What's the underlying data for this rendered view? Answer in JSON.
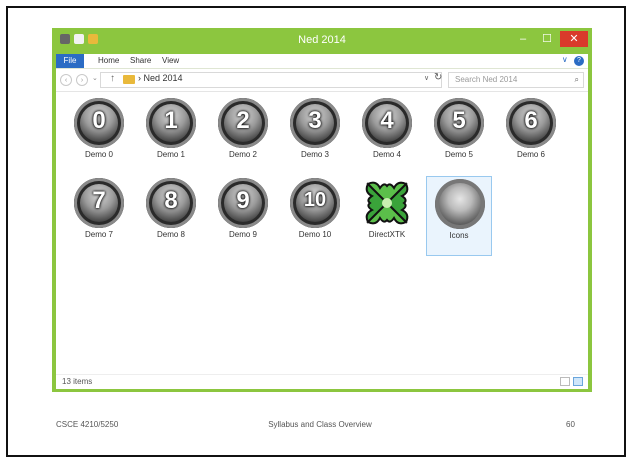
{
  "window": {
    "title": "Ned 2014",
    "ribbon_tabs": [
      "File",
      "Home",
      "Share",
      "View"
    ],
    "controls": {
      "minimize": "–",
      "maximize": "☐",
      "close": "✕"
    },
    "help": "?",
    "expand": "∨"
  },
  "address": {
    "back": "‹",
    "forward": "›",
    "recent": "⌄",
    "up": "↑",
    "separator": "›",
    "path": "Ned 2014",
    "dropdown": "∨",
    "refresh": "↻",
    "search_placeholder": "Search Ned 2014",
    "search_icon": "⌕"
  },
  "items": [
    {
      "label": "Demo 0",
      "number": "0",
      "icon": "demo-ball"
    },
    {
      "label": "Demo 1",
      "number": "1",
      "icon": "demo-ball"
    },
    {
      "label": "Demo 2",
      "number": "2",
      "icon": "demo-ball"
    },
    {
      "label": "Demo 3",
      "number": "3",
      "icon": "demo-ball"
    },
    {
      "label": "Demo 4",
      "number": "4",
      "icon": "demo-ball"
    },
    {
      "label": "Demo 5",
      "number": "5",
      "icon": "demo-ball"
    },
    {
      "label": "Demo 6",
      "number": "6",
      "icon": "demo-ball"
    },
    {
      "label": "Demo 7",
      "number": "7",
      "icon": "demo-ball"
    },
    {
      "label": "Demo 8",
      "number": "8",
      "icon": "demo-ball"
    },
    {
      "label": "Demo 9",
      "number": "9",
      "icon": "demo-ball"
    },
    {
      "label": "Demo 10",
      "number": "10",
      "icon": "demo-ball"
    },
    {
      "label": "DirectXTK",
      "number": "",
      "icon": "directxtk-logo"
    },
    {
      "label": "Icons",
      "number": "",
      "icon": "icons-ball",
      "selected": true
    }
  ],
  "status": {
    "count": "13 items"
  },
  "footer": {
    "course": "CSCE 4210/5250",
    "center": "Syllabus and Class Overview",
    "page": "60"
  },
  "colors": {
    "accent": "#8cc63f",
    "file_tab": "#2b6cc4",
    "close": "#d93a2b"
  }
}
